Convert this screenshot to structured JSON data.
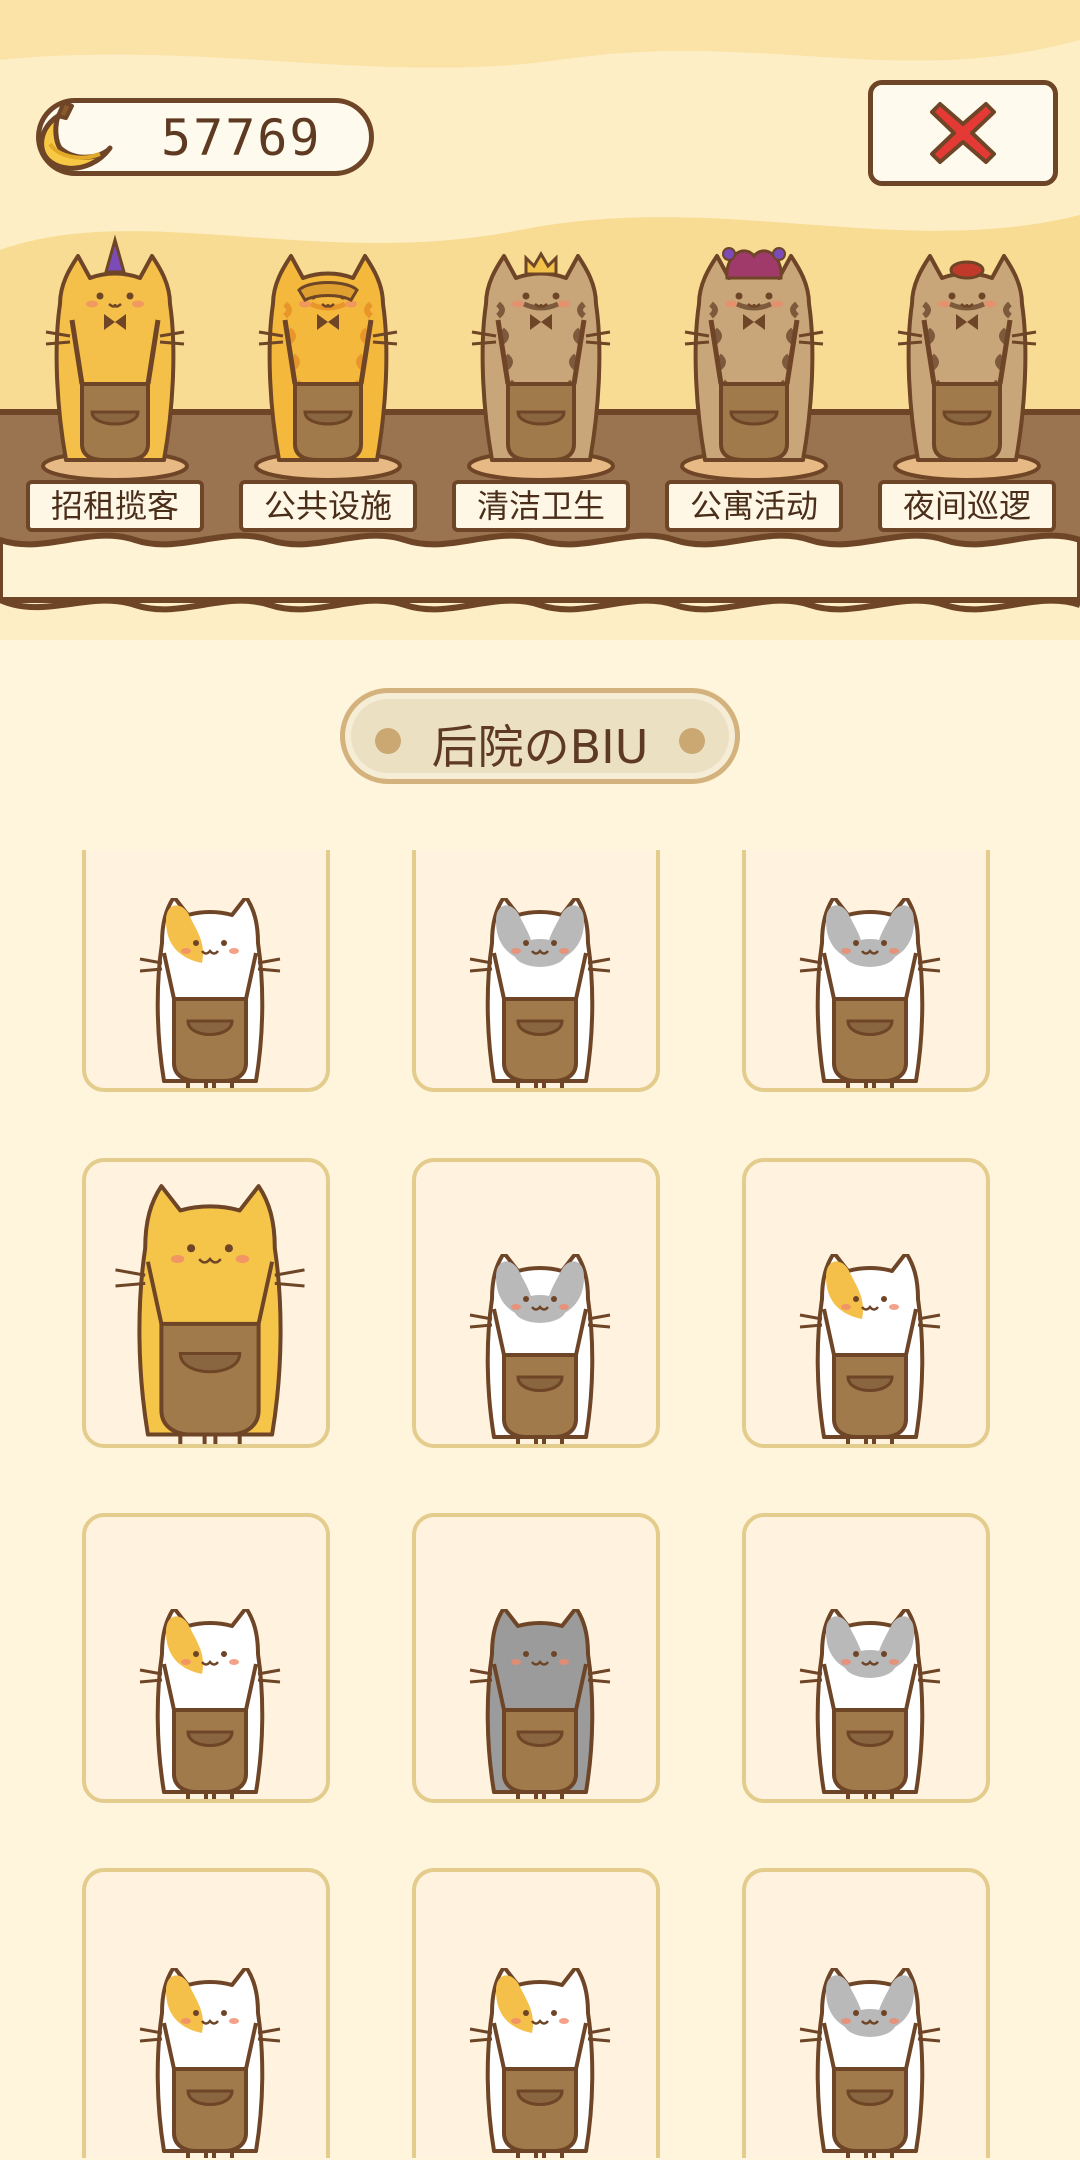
{
  "currency": {
    "icon": "banana-icon",
    "value": "57769"
  },
  "close": {
    "icon": "close-x-icon",
    "color": "#e53935"
  },
  "statues": [
    {
      "label": "招租揽客",
      "fur": "#f4c04a",
      "stripes": false,
      "hat": "wizard",
      "hatColor": "#7b4bb7"
    },
    {
      "label": "公共设施",
      "fur": "#f3b83c",
      "stripes": true,
      "stripeColor": "#e8962a",
      "hat": "mask",
      "hatColor": "#e0a030"
    },
    {
      "label": "清洁卫生",
      "fur": "#c9a57a",
      "stripes": true,
      "stripeColor": "#7e5a3c",
      "hat": "crown",
      "hatColor": "#f3c24a"
    },
    {
      "label": "公寓活动",
      "fur": "#c9a57a",
      "stripes": true,
      "stripeColor": "#7e5a3c",
      "hat": "jester",
      "hatColor": "#a03a6a"
    },
    {
      "label": "夜间巡逻",
      "fur": "#c9a57a",
      "stripes": true,
      "stripeColor": "#7e5a3c",
      "hat": "beret",
      "hatColor": "#c0392b"
    }
  ],
  "section_title": "后院のBIU",
  "cats": [
    {
      "pattern": "calico"
    },
    {
      "pattern": "gray-white"
    },
    {
      "pattern": "gray-white"
    },
    {
      "pattern": "orange-big"
    },
    {
      "pattern": "gray-white"
    },
    {
      "pattern": "calico"
    },
    {
      "pattern": "calico"
    },
    {
      "pattern": "dark-gray"
    },
    {
      "pattern": "gray-white"
    },
    {
      "pattern": "calico"
    },
    {
      "pattern": "calico"
    },
    {
      "pattern": "gray-white"
    }
  ],
  "colors": {
    "outline": "#6e4526",
    "apron": "#a17a4c",
    "cardBorder": "#e3cc8c",
    "cardBg": "#fff3e0"
  }
}
